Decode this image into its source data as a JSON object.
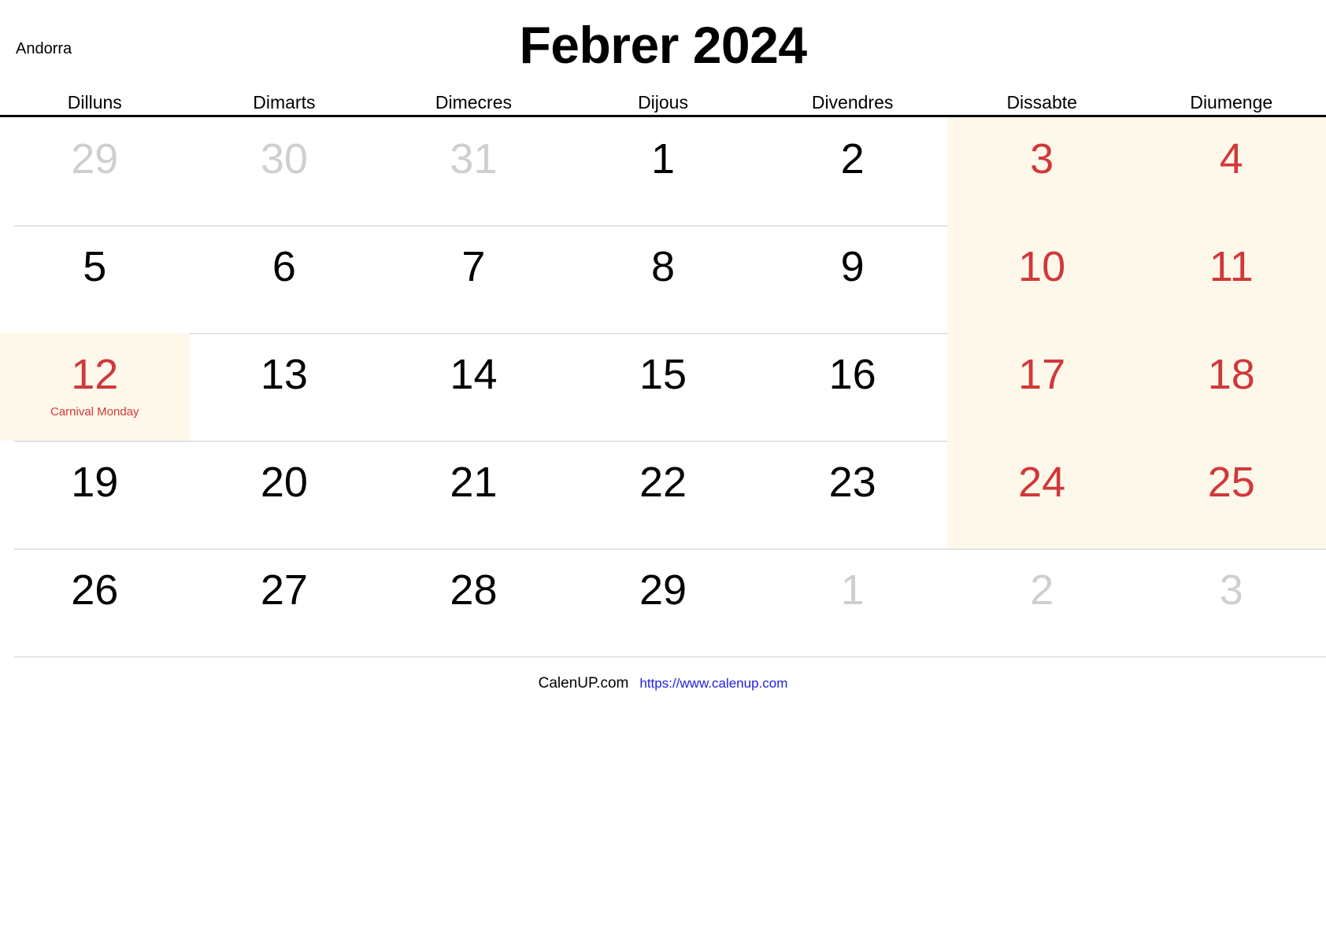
{
  "header": {
    "country": "Andorra",
    "title": "Febrer 2024"
  },
  "weekdays": [
    "Dilluns",
    "Dimarts",
    "Dimecres",
    "Dijous",
    "Divendres",
    "Dissabte",
    "Diumenge"
  ],
  "colors": {
    "weekend_text": "#d1383a",
    "weekend_background": "#fdf8e9",
    "muted_text": "#cfcfcf",
    "grid_line": "#e3e3e3",
    "header_rule": "#000000",
    "url_link": "#2020e0"
  },
  "weeks": [
    {
      "days": [
        {
          "number": "29",
          "state": "muted",
          "shaded": false,
          "holiday": ""
        },
        {
          "number": "30",
          "state": "muted",
          "shaded": false,
          "holiday": ""
        },
        {
          "number": "31",
          "state": "muted",
          "shaded": false,
          "holiday": ""
        },
        {
          "number": "1",
          "state": "normal",
          "shaded": false,
          "holiday": ""
        },
        {
          "number": "2",
          "state": "normal",
          "shaded": false,
          "holiday": ""
        },
        {
          "number": "3",
          "state": "weekend",
          "shaded": true,
          "holiday": ""
        },
        {
          "number": "4",
          "state": "weekend",
          "shaded": true,
          "holiday": ""
        }
      ]
    },
    {
      "days": [
        {
          "number": "5",
          "state": "normal",
          "shaded": false,
          "holiday": ""
        },
        {
          "number": "6",
          "state": "normal",
          "shaded": false,
          "holiday": ""
        },
        {
          "number": "7",
          "state": "normal",
          "shaded": false,
          "holiday": ""
        },
        {
          "number": "8",
          "state": "normal",
          "shaded": false,
          "holiday": ""
        },
        {
          "number": "9",
          "state": "normal",
          "shaded": false,
          "holiday": ""
        },
        {
          "number": "10",
          "state": "weekend",
          "shaded": true,
          "holiday": ""
        },
        {
          "number": "11",
          "state": "weekend",
          "shaded": true,
          "holiday": ""
        }
      ]
    },
    {
      "days": [
        {
          "number": "12",
          "state": "holiday",
          "shaded": true,
          "holiday": "Carnival Monday"
        },
        {
          "number": "13",
          "state": "normal",
          "shaded": false,
          "holiday": ""
        },
        {
          "number": "14",
          "state": "normal",
          "shaded": false,
          "holiday": ""
        },
        {
          "number": "15",
          "state": "normal",
          "shaded": false,
          "holiday": ""
        },
        {
          "number": "16",
          "state": "normal",
          "shaded": false,
          "holiday": ""
        },
        {
          "number": "17",
          "state": "weekend",
          "shaded": true,
          "holiday": ""
        },
        {
          "number": "18",
          "state": "weekend",
          "shaded": true,
          "holiday": ""
        }
      ]
    },
    {
      "days": [
        {
          "number": "19",
          "state": "normal",
          "shaded": false,
          "holiday": ""
        },
        {
          "number": "20",
          "state": "normal",
          "shaded": false,
          "holiday": ""
        },
        {
          "number": "21",
          "state": "normal",
          "shaded": false,
          "holiday": ""
        },
        {
          "number": "22",
          "state": "normal",
          "shaded": false,
          "holiday": ""
        },
        {
          "number": "23",
          "state": "normal",
          "shaded": false,
          "holiday": ""
        },
        {
          "number": "24",
          "state": "weekend",
          "shaded": true,
          "holiday": ""
        },
        {
          "number": "25",
          "state": "weekend",
          "shaded": true,
          "holiday": ""
        }
      ]
    },
    {
      "days": [
        {
          "number": "26",
          "state": "normal",
          "shaded": false,
          "holiday": ""
        },
        {
          "number": "27",
          "state": "normal",
          "shaded": false,
          "holiday": ""
        },
        {
          "number": "28",
          "state": "normal",
          "shaded": false,
          "holiday": ""
        },
        {
          "number": "29",
          "state": "normal",
          "shaded": false,
          "holiday": ""
        },
        {
          "number": "1",
          "state": "muted",
          "shaded": false,
          "holiday": ""
        },
        {
          "number": "2",
          "state": "muted",
          "shaded": false,
          "holiday": ""
        },
        {
          "number": "3",
          "state": "muted",
          "shaded": false,
          "holiday": ""
        }
      ]
    }
  ],
  "footer": {
    "brand": "CalenUP.com",
    "url": "https://www.calenup.com"
  }
}
